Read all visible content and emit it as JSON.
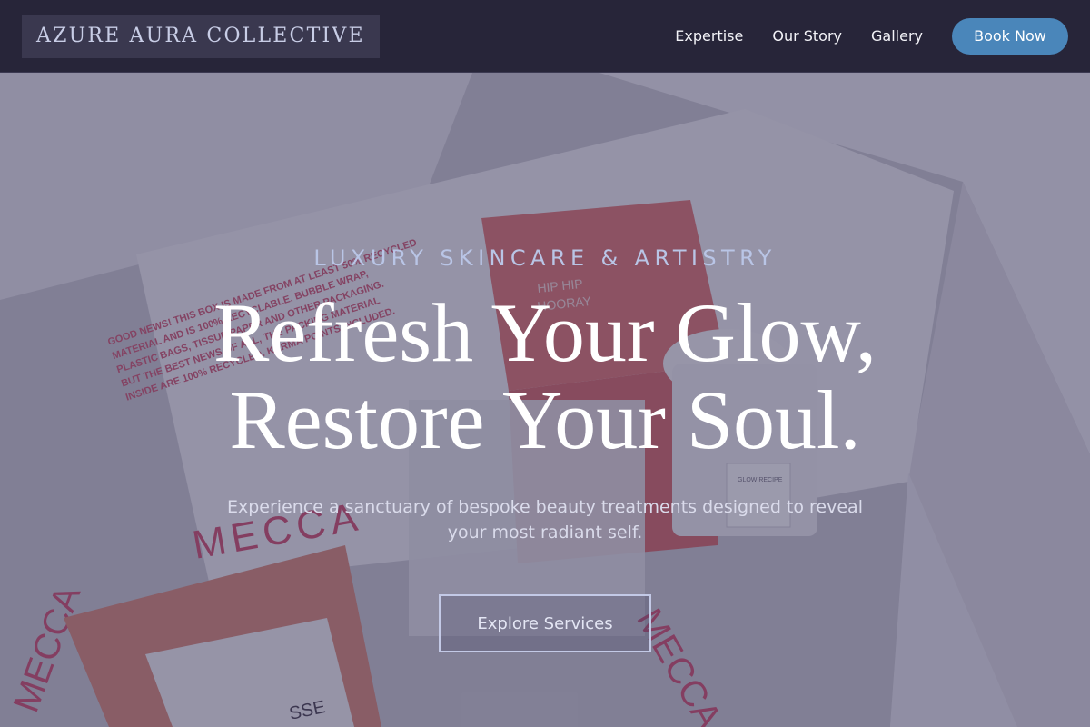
{
  "brand": {
    "name": "AZURE AURA COLLECTIVE"
  },
  "nav": {
    "links": [
      "Expertise",
      "Our Story",
      "Gallery"
    ],
    "cta_label": "Book Now"
  },
  "hero": {
    "eyebrow": "LUXURY SKINCARE & ARTISTRY",
    "headline_line1": "Refresh Your Glow,",
    "headline_line2": "Restore Your Soul.",
    "subtext": "Experience a sanctuary of bespoke beauty treatments designed to reveal your most radiant self.",
    "cta_label": "Explore Services",
    "image_text": {
      "box_notice": "GOOD NEWS! THIS BOX IS MADE FROM AT LEAST 50% RECYCLED MATERIAL AND IS 100% RECYCLABLE. PLEASE RECYCLE THE PACKING MATERIAL, BUBBLE WRAP, PLASTIC BAGS, TISSUE PAPER AND OTHER PACKAGING. BUT THE BEST NEWS OF ALL, THE PACKING MATERIAL INSIDE ARE 100% RECYCLED. KARMA POINTS INCLUDED.",
      "jar_label": "HIP HIP HOORAY",
      "brand_print": "MECCA",
      "small_jar_label": "GLOW RECIPE",
      "tube_label": "SSE"
    }
  },
  "colors": {
    "nav_bg": "#272539",
    "brand_bg": "#3a384f",
    "accent": "#4a86ba",
    "overlay": "#403e60",
    "eyebrow": "#b9c5e6"
  },
  "icons": []
}
